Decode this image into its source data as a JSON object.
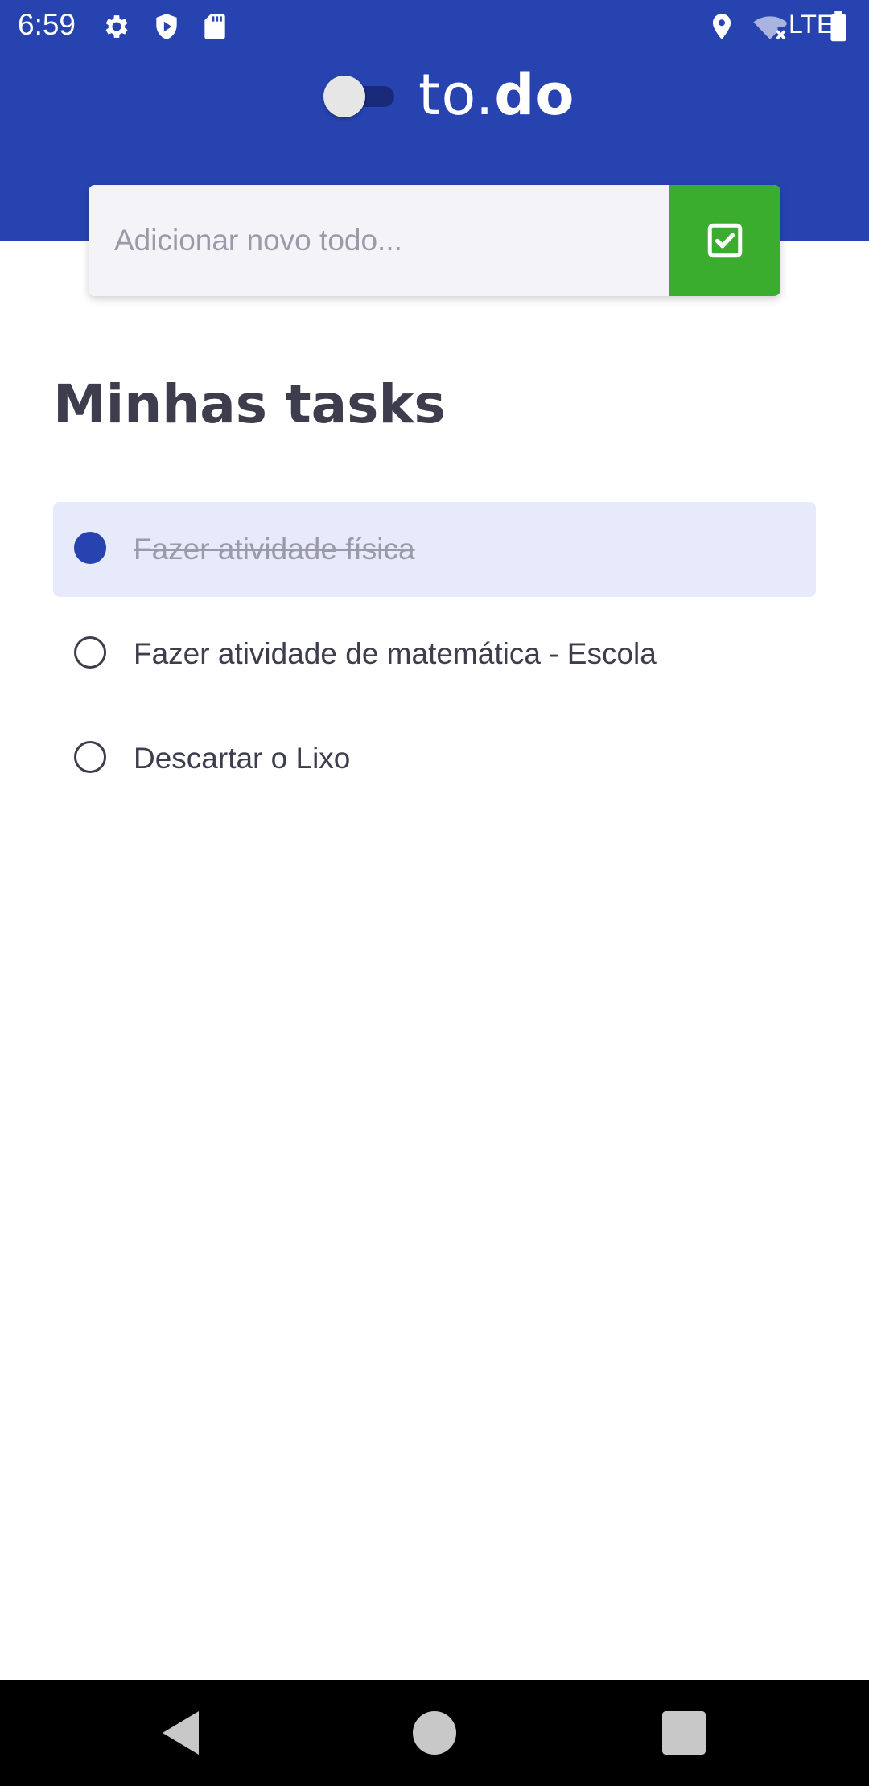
{
  "status_bar": {
    "time": "6:59",
    "network": "LTE",
    "icons": [
      "settings-icon",
      "shield-icon",
      "sd-card-icon",
      "location-icon",
      "wifi-off-icon",
      "battery-icon"
    ]
  },
  "header": {
    "logo_part1": "to.",
    "logo_part2": "do",
    "theme_toggle_on": false
  },
  "add_todo": {
    "placeholder": "Adicionar novo todo...",
    "value": "",
    "button_icon": "checkbox-check-icon"
  },
  "section": {
    "title": "Minhas tasks"
  },
  "tasks": [
    {
      "label": "Fazer atividade física",
      "done": true
    },
    {
      "label": "Fazer atividade de matemática - Escola",
      "done": false
    },
    {
      "label": "Descartar o Lixo",
      "done": false
    }
  ],
  "nav_bar": {
    "icons": [
      "back-icon",
      "home-icon",
      "recents-icon"
    ]
  },
  "colors": {
    "primary": "#2743b0",
    "accent_green": "#3bad2e",
    "text": "#3d3d4d",
    "done_bg": "#e6eafa"
  }
}
